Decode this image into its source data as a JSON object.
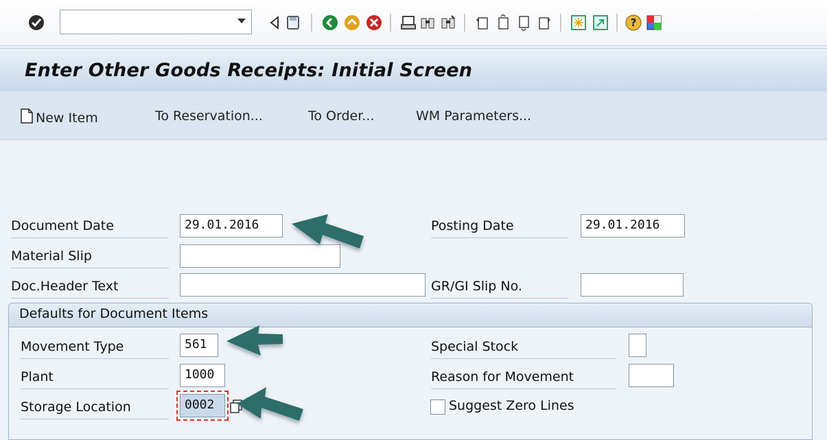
{
  "toolbar": {
    "command_field_value": "",
    "icons": [
      "check-icon",
      "back-icon",
      "save-icon",
      "back-nav-icon",
      "exit-icon",
      "cancel-icon",
      "print-icon",
      "find-icon",
      "find-next-icon",
      "first-page-icon",
      "prev-page-icon",
      "next-page-icon",
      "last-page-icon",
      "new-session-icon",
      "shortcut-icon",
      "help-icon",
      "customize-layout-icon"
    ]
  },
  "title": "Enter Other Goods Receipts: Initial Screen",
  "app_toolbar": {
    "new_item": "New Item",
    "to_reservation": "To Reservation...",
    "to_order": "To Order...",
    "wm_parameters": "WM Parameters..."
  },
  "form": {
    "document_date_label": "Document Date",
    "document_date_value": "29.01.2016",
    "posting_date_label": "Posting Date",
    "posting_date_value": "29.01.2016",
    "material_slip_label": "Material Slip",
    "material_slip_value": "",
    "doc_header_text_label": "Doc.Header Text",
    "doc_header_text_value": "",
    "gr_gi_slip_label": "GR/GI Slip No.",
    "gr_gi_slip_value": ""
  },
  "defaults": {
    "group_title": "Defaults for Document Items",
    "movement_type_label": "Movement Type",
    "movement_type_value": "561",
    "plant_label": "Plant",
    "plant_value": "1000",
    "storage_location_label": "Storage Location",
    "storage_location_value": "0002",
    "special_stock_label": "Special Stock",
    "special_stock_value": "",
    "reason_label": "Reason for Movement",
    "reason_value": "",
    "suggest_zero_lines_label": "Suggest Zero Lines",
    "suggest_zero_lines_checked": false
  },
  "colors": {
    "arrow": "#2f6d6a",
    "focus_border": "#d9342b"
  }
}
